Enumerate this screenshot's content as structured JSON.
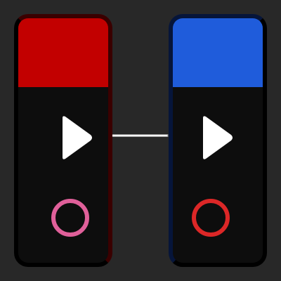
{
  "canvas": {
    "background": "#282828"
  },
  "nodes": [
    {
      "id": "source",
      "header_color": "#c20000",
      "body_color": "#0d0d0d",
      "output_icon": "play-icon",
      "ring_icon": "ring-icon",
      "ring_color": "#e0609a"
    },
    {
      "id": "target",
      "header_color": "#1f5cdb",
      "body_color": "#0d0d0d",
      "input_icon": "play-icon",
      "ring_icon": "ring-icon",
      "ring_color": "#dc2727"
    }
  ],
  "connection": {
    "from": "source",
    "to": "target",
    "color": "#ffffff",
    "active": true
  }
}
